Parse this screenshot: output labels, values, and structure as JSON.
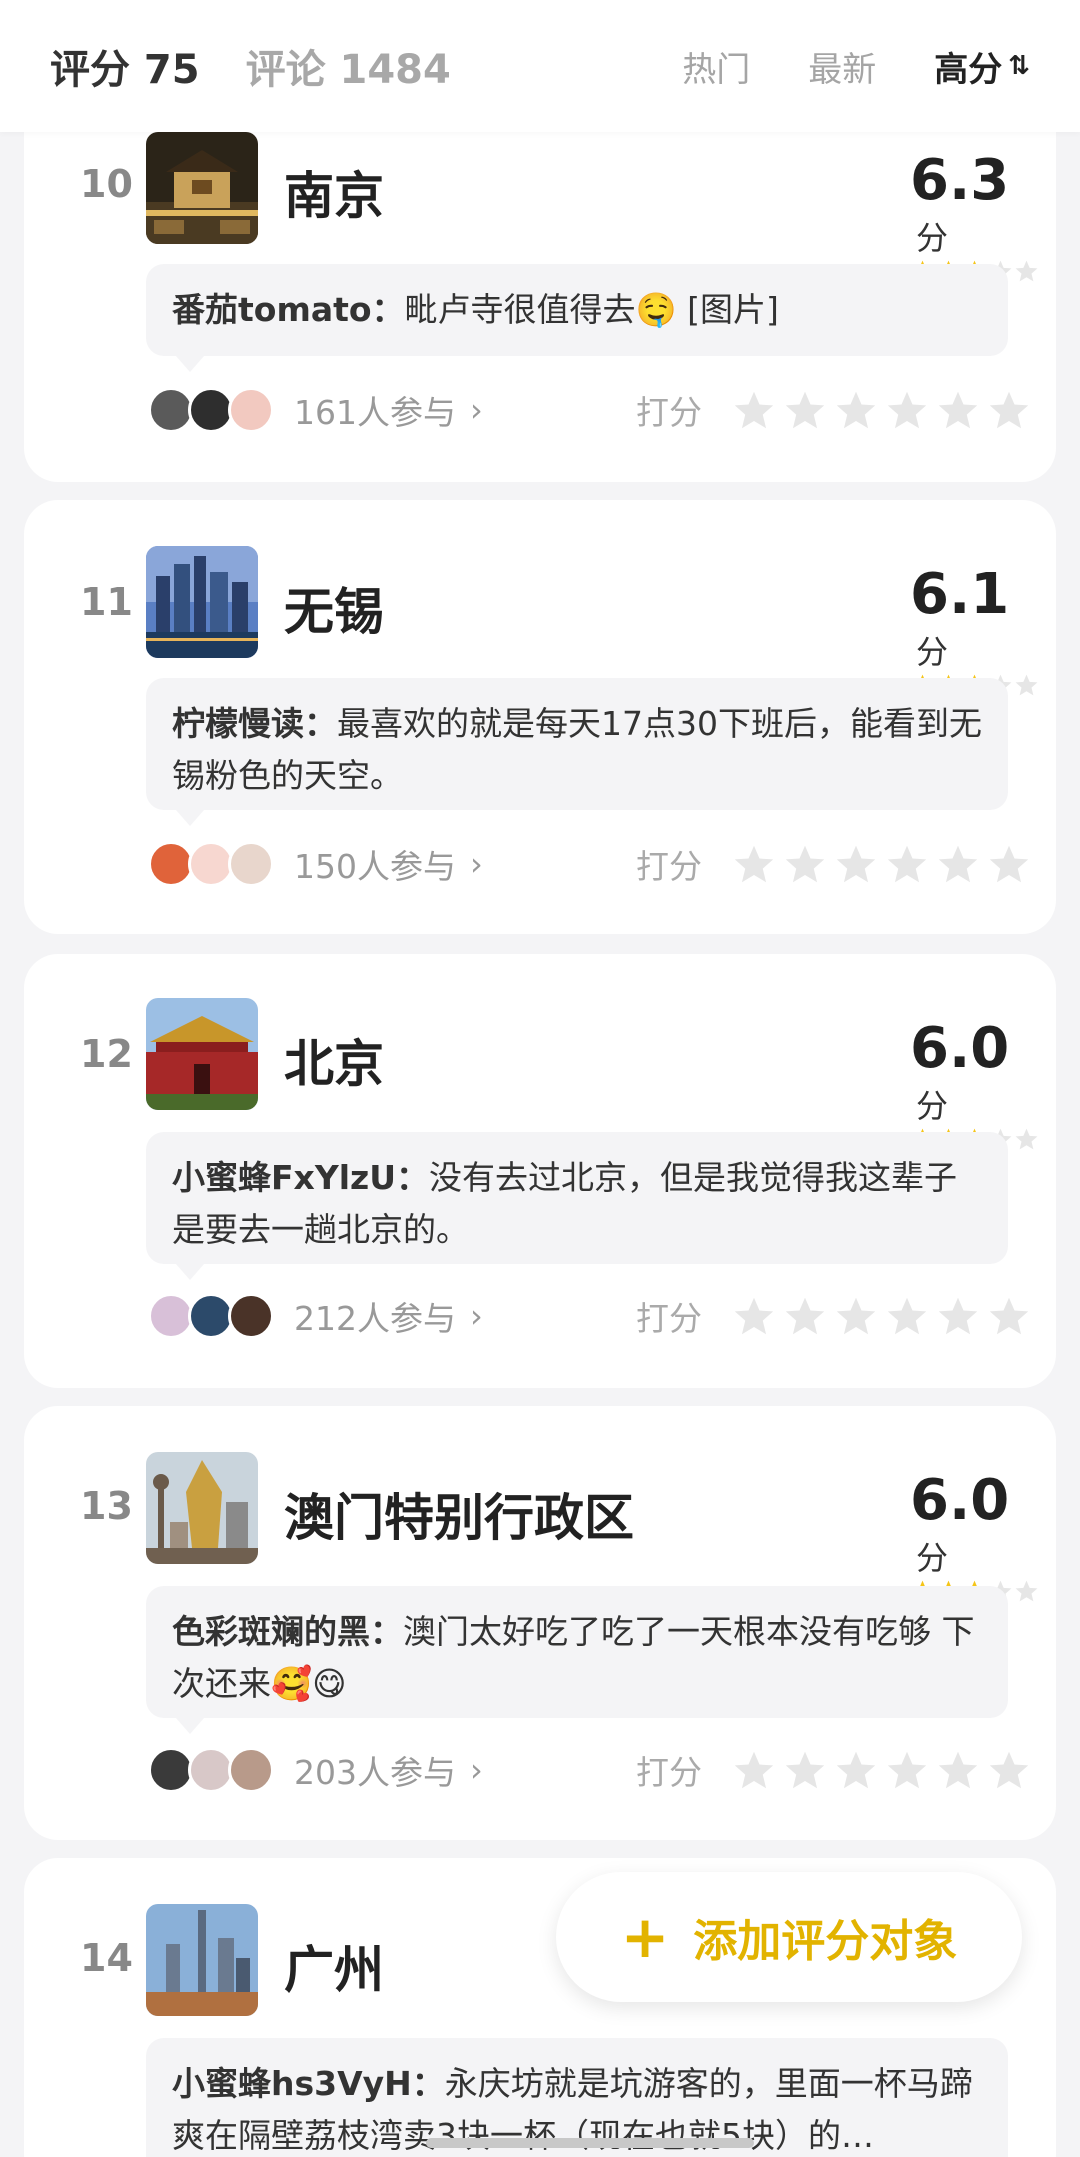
{
  "header": {
    "score_label": "评分 75",
    "comment_label": "评论 1484",
    "sort_hot": "热门",
    "sort_new": "最新",
    "sort_high": "高分",
    "sort_icon": "⇅"
  },
  "items": [
    {
      "rank": "10",
      "city": "南京",
      "score": "6.3",
      "unit": "分",
      "stars_filled": 3,
      "comment_user": "番茄tomato：",
      "comment_text": "毗卢寺很值得去",
      "comment_suffix": " [图片]",
      "emoji": "🤤",
      "participants": "161人参与",
      "rate_label": "打分"
    },
    {
      "rank": "11",
      "city": "无锡",
      "score": "6.1",
      "unit": "分",
      "stars_filled": 3,
      "comment_user": "柠檬慢读：",
      "comment_text": "最喜欢的就是每天17点30下班后，能看到无锡粉色的天空。",
      "participants": "150人参与",
      "rate_label": "打分"
    },
    {
      "rank": "12",
      "city": "北京",
      "score": "6.0",
      "unit": "分",
      "stars_filled": 3,
      "comment_user": "小蜜蜂FxYlzU：",
      "comment_text": "没有去过北京，但是我觉得我这辈子是要去一趟北京的。",
      "participants": "212人参与",
      "rate_label": "打分"
    },
    {
      "rank": "13",
      "city": "澳门特别行政区",
      "score": "6.0",
      "unit": "分",
      "stars_filled": 3,
      "comment_user": "色彩斑斓的黑：",
      "comment_text": "澳门太好吃了吃了一天根本没有吃够 下次还来🥰😋",
      "participants": "203人参与",
      "rate_label": "打分"
    },
    {
      "rank": "14",
      "city": "广州",
      "score": "",
      "unit": "",
      "stars_filled": 3,
      "comment_user": "小蜜蜂hs3VyH：",
      "comment_text": "永庆坊就是坑游客的，里面一杯马蹄爽在隔壁荔枝湾卖3块一杯（现在也就5块）的…"
    }
  ],
  "fab": {
    "plus": "+",
    "label": "添加评分对象"
  },
  "colors": {
    "accent": "#ffd83a",
    "star": "#f5c518",
    "star_empty": "#e6e6e6"
  }
}
